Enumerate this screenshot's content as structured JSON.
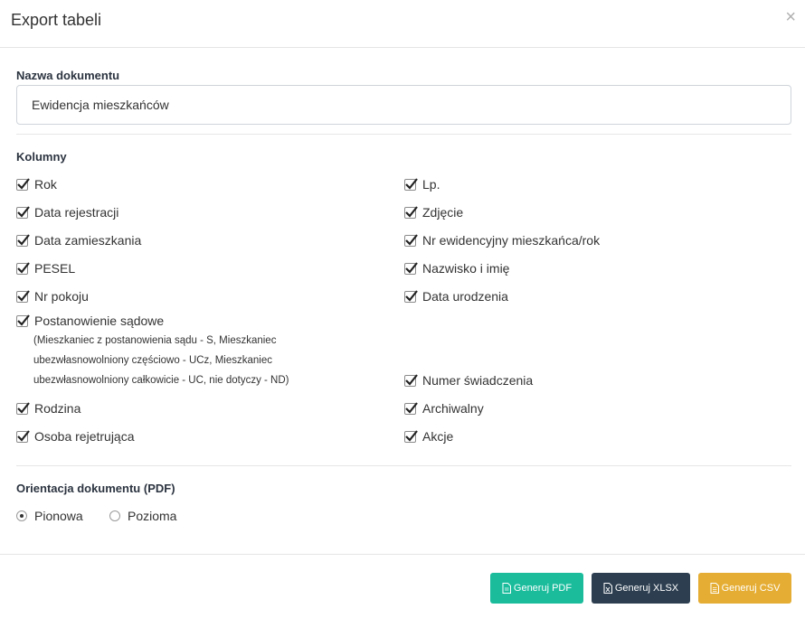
{
  "dialog": {
    "title": "Export tabeli",
    "close_glyph": "×"
  },
  "document_name": {
    "label": "Nazwa dokumentu",
    "value": "Ewidencja mieszkańców"
  },
  "columns": {
    "label": "Kolumny",
    "left": [
      {
        "label": "Rok",
        "checked": true
      },
      {
        "label": "Data rejestracji",
        "checked": true
      },
      {
        "label": "Data zamieszkania",
        "checked": true
      },
      {
        "label": "PESEL",
        "checked": true
      },
      {
        "label": "Nr pokoju",
        "checked": true
      },
      {
        "label": "Postanowienie sądowe",
        "checked": true,
        "note": [
          "(Mieszkaniec z postanowienia sądu - S, Mieszkaniec",
          "ubezwłasnowolniony częściowo - UCz, Mieszkaniec",
          "ubezwłasnowolniony całkowicie - UC, nie dotyczy - ND)"
        ]
      },
      {
        "label": "Rodzina",
        "checked": true
      },
      {
        "label": "Osoba rejetrująca",
        "checked": true
      }
    ],
    "right": [
      {
        "label": "Lp.",
        "checked": true
      },
      {
        "label": "Zdjęcie",
        "checked": true
      },
      {
        "label": "Nr ewidencyjny mieszkańca/rok",
        "checked": true
      },
      {
        "label": "Nazwisko i imię",
        "checked": true
      },
      {
        "label": "Data urodzenia",
        "checked": true
      },
      {
        "label": "Numer świadczenia",
        "checked": true
      },
      {
        "label": "Archiwalny",
        "checked": true
      },
      {
        "label": "Akcje",
        "checked": true
      }
    ]
  },
  "orientation": {
    "label": "Orientacja dokumentu (PDF)",
    "options": [
      {
        "label": "Pionowa",
        "selected": true
      },
      {
        "label": "Pozioma",
        "selected": false
      }
    ]
  },
  "footer": {
    "pdf_label": "Generuj PDF",
    "xlsx_label": "Generuj XLSX",
    "csv_label": "Generuj CSV"
  },
  "colors": {
    "pdf": "#1abc9c",
    "xlsx": "#2c3e50",
    "csv": "#e5ad33"
  },
  "icons": {
    "close": "close-icon",
    "checkbox": "checkmark-icon",
    "pdf": "file-pdf-icon",
    "xlsx": "file-excel-icon",
    "csv": "file-text-icon"
  }
}
